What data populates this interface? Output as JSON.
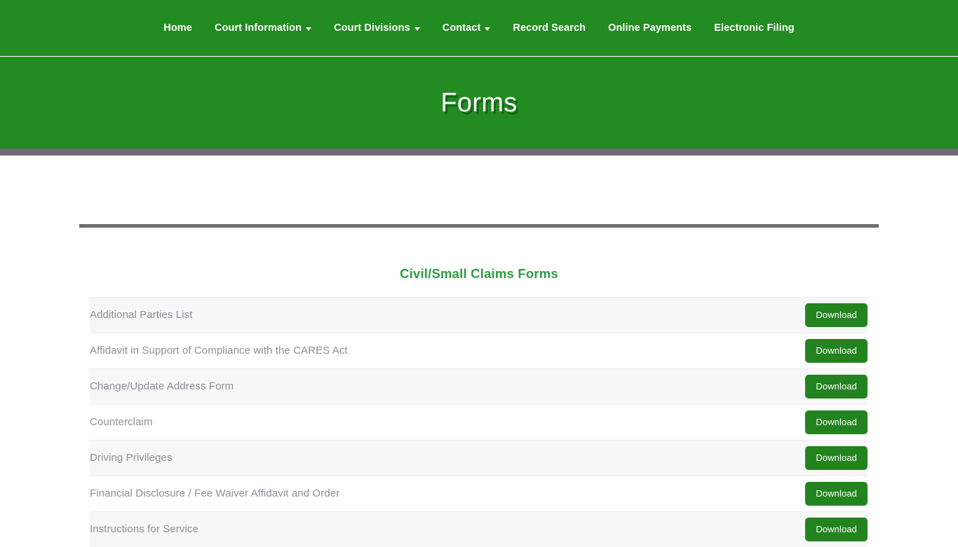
{
  "nav": {
    "items": [
      {
        "label": "Home",
        "has_dropdown": false
      },
      {
        "label": "Court Information",
        "has_dropdown": true
      },
      {
        "label": "Court Divisions",
        "has_dropdown": true
      },
      {
        "label": "Contact",
        "has_dropdown": true
      },
      {
        "label": "Record Search",
        "has_dropdown": false
      },
      {
        "label": "Online Payments",
        "has_dropdown": false
      },
      {
        "label": "Electronic Filing",
        "has_dropdown": false
      }
    ]
  },
  "banner": {
    "title": "Forms"
  },
  "main": {
    "section_title": "Civil/Small Claims Forms",
    "download_label": "Download",
    "rows": [
      {
        "name": "Additional Parties List"
      },
      {
        "name": "Affidavit in Support of Compliance with the CARES Act"
      },
      {
        "name": "Change/Update Address Form"
      },
      {
        "name": "Counterclaim"
      },
      {
        "name": "Driving Privileges"
      },
      {
        "name": "Financial Disclosure / Fee Waiver Affidavit and Order"
      },
      {
        "name": "Instructions for Service"
      }
    ]
  },
  "colors": {
    "brand_green": "#228b22",
    "button_green": "#23841f",
    "heading_green": "#2e9b3f",
    "rule_gray": "#6b6b75",
    "section_rule_gray": "#6e6e6e",
    "row_alt": "#f7f7f8",
    "row_text": "#8b8f96"
  }
}
